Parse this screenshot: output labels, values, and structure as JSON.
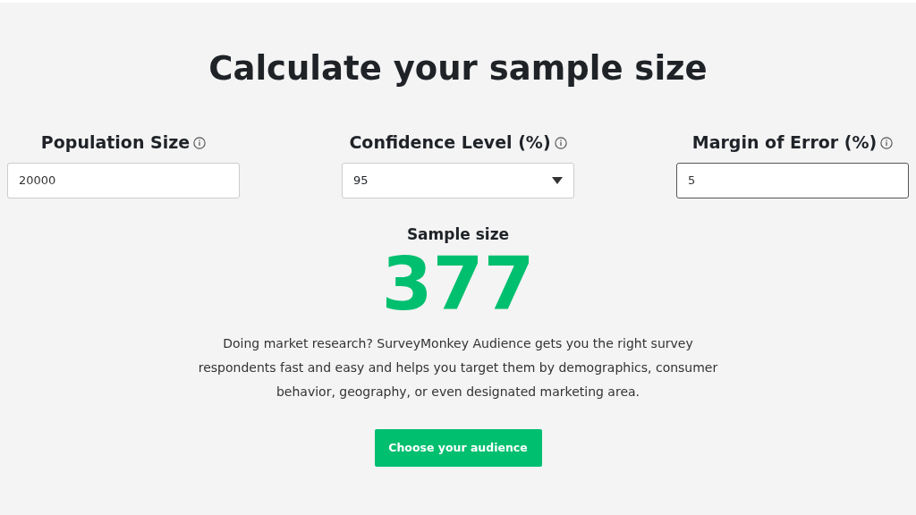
{
  "title": "Calculate your sample size",
  "fields": [
    {
      "label": "Population Size",
      "kind": "text",
      "value": "20000",
      "focused": false
    },
    {
      "label": "Confidence Level (%)",
      "kind": "select",
      "value": "95",
      "focused": false
    },
    {
      "label": "Margin of Error (%)",
      "kind": "text",
      "value": "5",
      "focused": true
    }
  ],
  "result": {
    "label": "Sample size",
    "value": "377"
  },
  "description": "Doing market research? SurveyMonkey Audience gets you the right survey respondents fast and easy and helps you target them by demographics, consumer behavior, geography, or even designated marketing area.",
  "button": "Choose your audience"
}
